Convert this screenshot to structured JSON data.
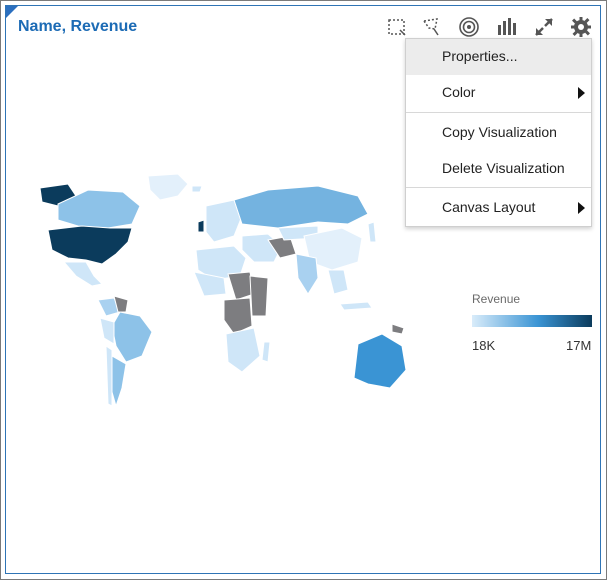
{
  "panel": {
    "title": "Name, Revenue"
  },
  "toolbar": {
    "icons": [
      "marquee-select-icon",
      "lasso-select-icon",
      "target-icon",
      "bar-chart-icon",
      "expand-icon",
      "gear-icon"
    ]
  },
  "legend": {
    "title": "Revenue",
    "min_label": "18K",
    "max_label": "17M",
    "color_low": "#d9ecfa",
    "color_high": "#0b3b5c"
  },
  "menu": {
    "items": [
      {
        "label": "Properties...",
        "has_submenu": false
      },
      {
        "label": "Color",
        "has_submenu": true
      },
      {
        "label": "Copy Visualization",
        "has_submenu": false
      },
      {
        "label": "Delete Visualization",
        "has_submenu": false
      },
      {
        "label": "Canvas Layout",
        "has_submenu": true
      }
    ]
  },
  "colors": {
    "title": "#1c6bb5",
    "no_data": "#7d7d80",
    "usa": "#0b3b5c",
    "australia": "#3a94d4",
    "russia": "#74b3e0",
    "light": "#cfe6f8"
  }
}
